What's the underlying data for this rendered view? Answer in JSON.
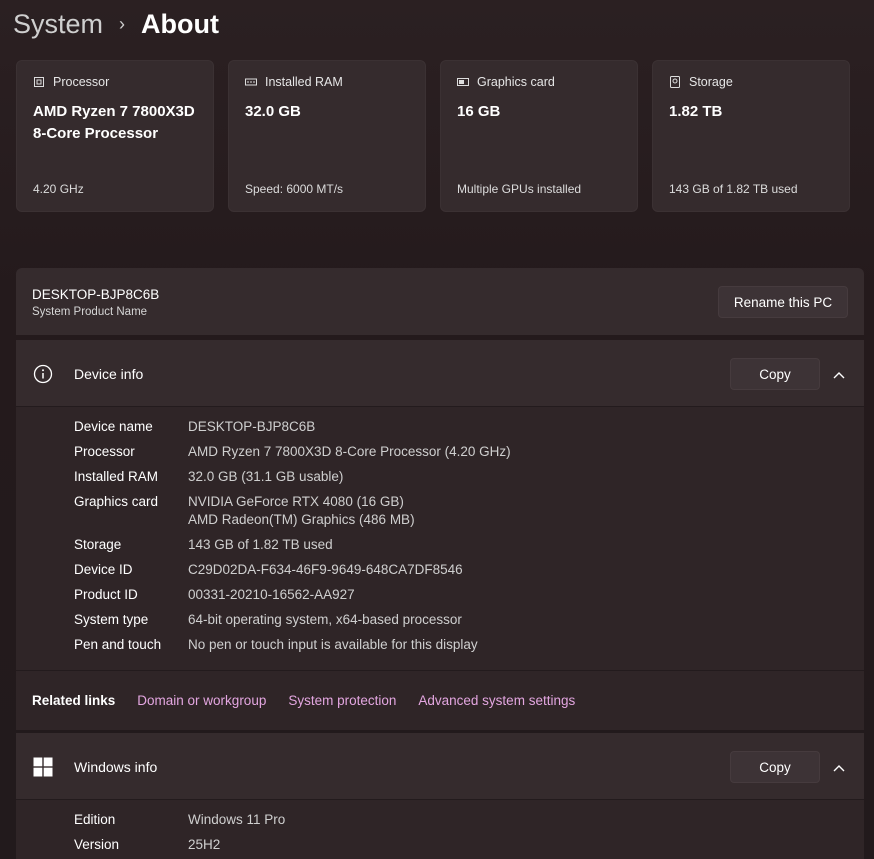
{
  "breadcrumb": {
    "parent": "System",
    "separator": "›",
    "current": "About"
  },
  "specs": [
    {
      "label": "Processor",
      "value": "AMD Ryzen 7 7800X3D 8-Core Processor",
      "sub": "4.20 GHz",
      "icon": "processor-icon"
    },
    {
      "label": "Installed RAM",
      "value": "32.0 GB",
      "sub": "Speed: 6000 MT/s",
      "icon": "ram-icon"
    },
    {
      "label": "Graphics card",
      "value": "16 GB",
      "sub": "Multiple GPUs installed",
      "icon": "graphics-card-icon"
    },
    {
      "label": "Storage",
      "value": "1.82 TB",
      "sub": "143 GB of 1.82 TB used",
      "icon": "storage-icon"
    }
  ],
  "pc": {
    "name": "DESKTOP-BJP8C6B",
    "sub": "System Product Name",
    "rename_label": "Rename this PC"
  },
  "device_info": {
    "title": "Device info",
    "copy_label": "Copy",
    "rows": [
      {
        "key": "Device name",
        "value": "DESKTOP-BJP8C6B"
      },
      {
        "key": "Processor",
        "value": "AMD Ryzen 7 7800X3D 8-Core Processor (4.20 GHz)"
      },
      {
        "key": "Installed RAM",
        "value": "32.0 GB (31.1 GB usable)"
      },
      {
        "key": "Graphics card",
        "value": "NVIDIA GeForce RTX 4080 (16 GB)",
        "value2": "AMD Radeon(TM) Graphics (486 MB)"
      },
      {
        "key": "Storage",
        "value": "143 GB of 1.82 TB used"
      },
      {
        "key": "Device ID",
        "value": "C29D02DA-F634-46F9-9649-648CA7DF8546"
      },
      {
        "key": "Product ID",
        "value": "00331-20210-16562-AA927"
      },
      {
        "key": "System type",
        "value": "64-bit operating system, x64-based processor"
      },
      {
        "key": "Pen and touch",
        "value": "No pen or touch input is available for this display"
      }
    ]
  },
  "related": {
    "label": "Related links",
    "links": [
      "Domain or workgroup",
      "System protection",
      "Advanced system settings"
    ]
  },
  "windows_info": {
    "title": "Windows info",
    "copy_label": "Copy",
    "rows": [
      {
        "key": "Edition",
        "value": "Windows 11 Pro"
      },
      {
        "key": "Version",
        "value": "25H2"
      }
    ]
  },
  "colors": {
    "link": "#e3a6e0",
    "card": "#352b2d",
    "background": "#231a1c"
  }
}
